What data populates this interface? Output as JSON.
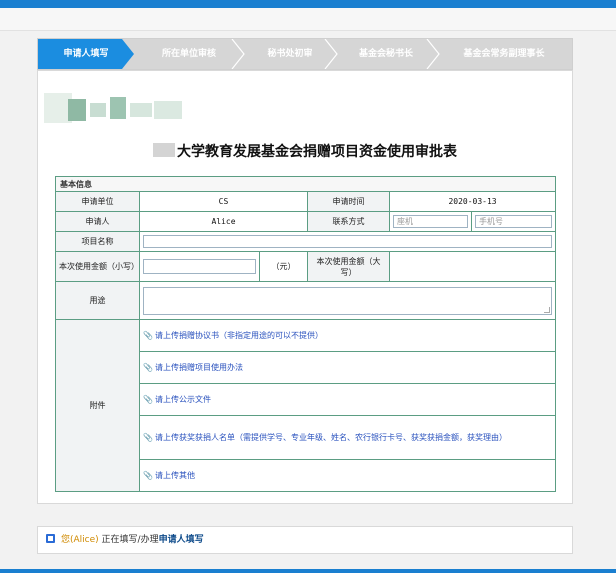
{
  "steps": [
    {
      "label": "申请人填写",
      "active": true
    },
    {
      "label": "所在单位审核",
      "active": false
    },
    {
      "label": "秘书处初审",
      "active": false
    },
    {
      "label": "基金会秘书长",
      "active": false
    },
    {
      "label": "基金会常务副理事长",
      "active": false
    }
  ],
  "form": {
    "title": "大学教育发展基金会捐赠项目资金使用审批表",
    "section_basic": "基本信息",
    "apply_unit_label": "申请单位",
    "apply_unit_value": "CS",
    "apply_time_label": "申请时间",
    "apply_time_value": "2020-03-13",
    "applicant_label": "申请人",
    "applicant_value": "Alice",
    "contact_label": "联系方式",
    "landline_placeholder": "座机",
    "mobile_placeholder": "手机号",
    "project_label": "项目名称",
    "amount_small_label": "本次使用金额（小写）",
    "amount_unit": "（元）",
    "amount_big_label": "本次使用金额（大写）",
    "purpose_label": "用途",
    "attachments_label": "附件",
    "uploads": [
      "请上传捐赠协议书（非指定用途的可以不提供）",
      "请上传捐赠项目使用办法",
      "请上传公示文件",
      "请上传获奖获捐人名单（需提供学号、专业年级、姓名、农行银行卡号、获奖获捐金额，获奖理由）",
      "请上传其他"
    ]
  },
  "status": {
    "you": "您(Alice)",
    "text": "正在填写/办理",
    "action": "申请人填写"
  },
  "colors": {
    "accent": "#1b8de0",
    "table_border": "#5b9d83",
    "link": "#2a52be"
  }
}
